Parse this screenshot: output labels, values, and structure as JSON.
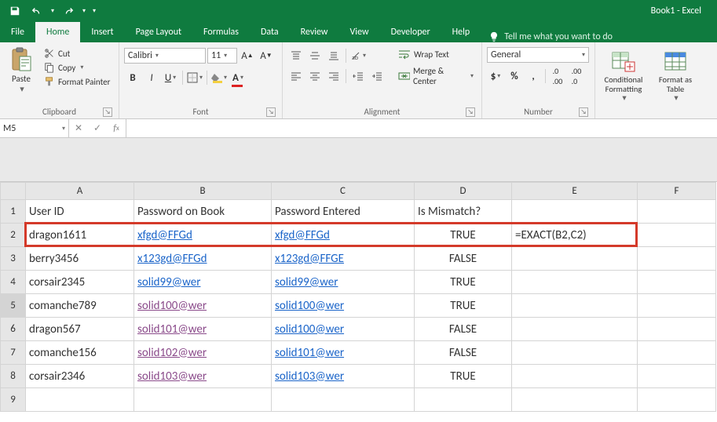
{
  "app": {
    "title": "Book1 - Excel"
  },
  "tabs": {
    "file": "File",
    "home": "Home",
    "insert": "Insert",
    "page_layout": "Page Layout",
    "formulas": "Formulas",
    "data": "Data",
    "review": "Review",
    "view": "View",
    "developer": "Developer",
    "help": "Help",
    "tell_me": "Tell me what you want to do"
  },
  "ribbon": {
    "clipboard": {
      "paste": "Paste",
      "cut": "Cut",
      "copy": "Copy",
      "format_painter": "Format Painter",
      "label": "Clipboard"
    },
    "font": {
      "name": "Calibri",
      "size": "11",
      "label": "Font"
    },
    "alignment": {
      "wrap": "Wrap Text",
      "merge": "Merge & Center",
      "label": "Alignment"
    },
    "number": {
      "format": "General",
      "label": "Number"
    },
    "styles": {
      "cond": "Conditional Formatting",
      "table": "Format as Table"
    }
  },
  "namebox": "M5",
  "formula": "",
  "columns": [
    "A",
    "B",
    "C",
    "D",
    "E",
    "F"
  ],
  "headers": {
    "A": "User ID",
    "B": "Password on Book",
    "C": "Password Entered",
    "D": "Is Mismatch?"
  },
  "rows": [
    {
      "n": 1,
      "A": "User ID",
      "B": "Password on Book",
      "C": "Password Entered",
      "D": "Is Mismatch?",
      "E": "",
      "F": ""
    },
    {
      "n": 2,
      "A": "dragon1611",
      "B": "xfgd@FFGd",
      "C": "xfgd@FFGd",
      "D": "TRUE",
      "E": "=EXACT(B2,C2)",
      "F": ""
    },
    {
      "n": 3,
      "A": "berry3456",
      "B": "x123gd@FFGd",
      "C": "x123gd@FFGE",
      "D": "FALSE",
      "E": "",
      "F": ""
    },
    {
      "n": 4,
      "A": "corsair2345",
      "B": "solid99@wer",
      "C": "solid99@wer",
      "D": "TRUE",
      "E": "",
      "F": ""
    },
    {
      "n": 5,
      "A": "comanche789",
      "B": "solid100@wer",
      "C": "solid100@wer",
      "D": "TRUE",
      "E": "",
      "F": ""
    },
    {
      "n": 6,
      "A": "dragon567",
      "B": "solid101@wer",
      "C": "solid100@wer",
      "D": "FALSE",
      "E": "",
      "F": ""
    },
    {
      "n": 7,
      "A": "comanche156",
      "B": "solid102@wer",
      "C": "solid101@wer",
      "D": "FALSE",
      "E": "",
      "F": ""
    },
    {
      "n": 8,
      "A": "corsair2346",
      "B": "solid103@wer",
      "C": "solid103@wer",
      "D": "TRUE",
      "E": "",
      "F": ""
    },
    {
      "n": 9,
      "A": "",
      "B": "",
      "C": "",
      "D": "",
      "E": "",
      "F": ""
    }
  ],
  "link_style": {
    "blue_rows_B": [
      2,
      3,
      4
    ],
    "visited_rows_B": [
      5,
      6,
      7,
      8
    ],
    "blue_rows_C": [
      2,
      3,
      4,
      5,
      6,
      7,
      8
    ]
  }
}
